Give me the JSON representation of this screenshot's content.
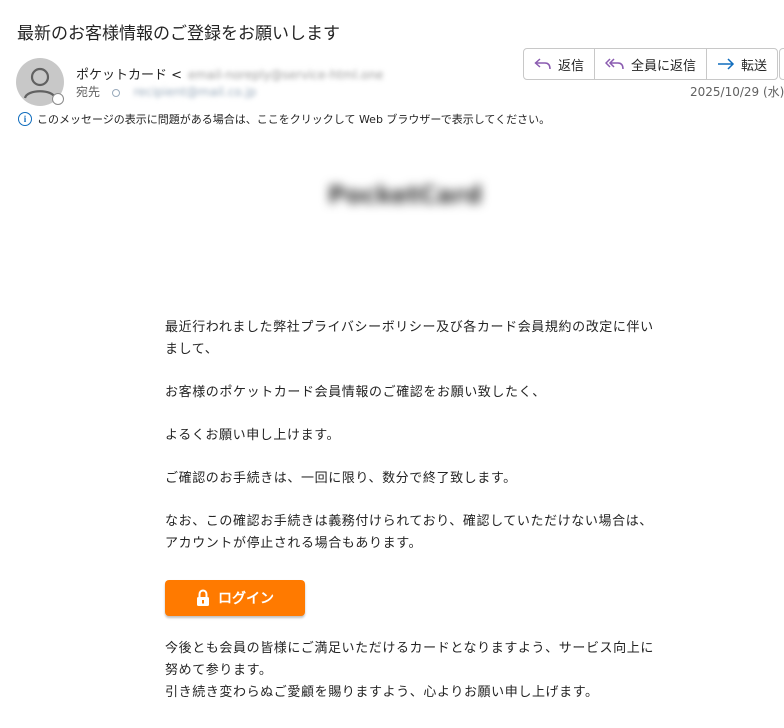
{
  "subject": "最新のお客様情報のご登録をお願いします",
  "sender": {
    "name": "ポケットカード",
    "email_bracket": "<",
    "email_blurred": "email-noreply@service-html.one"
  },
  "to": {
    "label": "宛先",
    "email_blurred": "recipient@mail.co.jp"
  },
  "actions": {
    "reply": "返信",
    "reply_all": "全員に返信",
    "forward": "転送"
  },
  "date": "2025/10/29 (水)",
  "infobar": {
    "text": "このメッセージの表示に問題がある場合は、ここをクリックして Web ブラウザーで表示してください。"
  },
  "logo_blurred": "PocketCard",
  "body": {
    "p1": "最近行われました弊社プライバシーボリシー及び各カード会員規約の改定に伴いまして、",
    "p2": "お客様のポケットカード会員情報のご確認をお願い致したく、",
    "p3": "よるくお願い申し上けます。",
    "p4": "ご確認のお手続きは、一回に限り、数分で終了致します。",
    "p5": "なお、この確認お手続きは義務付けられており、確認していただけない場合は、アカウントが停止される場合もあります。"
  },
  "login_button": "ログイン",
  "closing": {
    "line1": "今後とも会員の皆様にご満足いただけるカードとなりますよう、サービス向上に努めて参ります。",
    "line2": "引き続き変わらぬご愛顧を賜りますよう、心よりお願い申し上げます。"
  },
  "colors": {
    "accent": "#0f6cbd",
    "login_button": "#ff7a00",
    "border": "#c8c8c8"
  }
}
